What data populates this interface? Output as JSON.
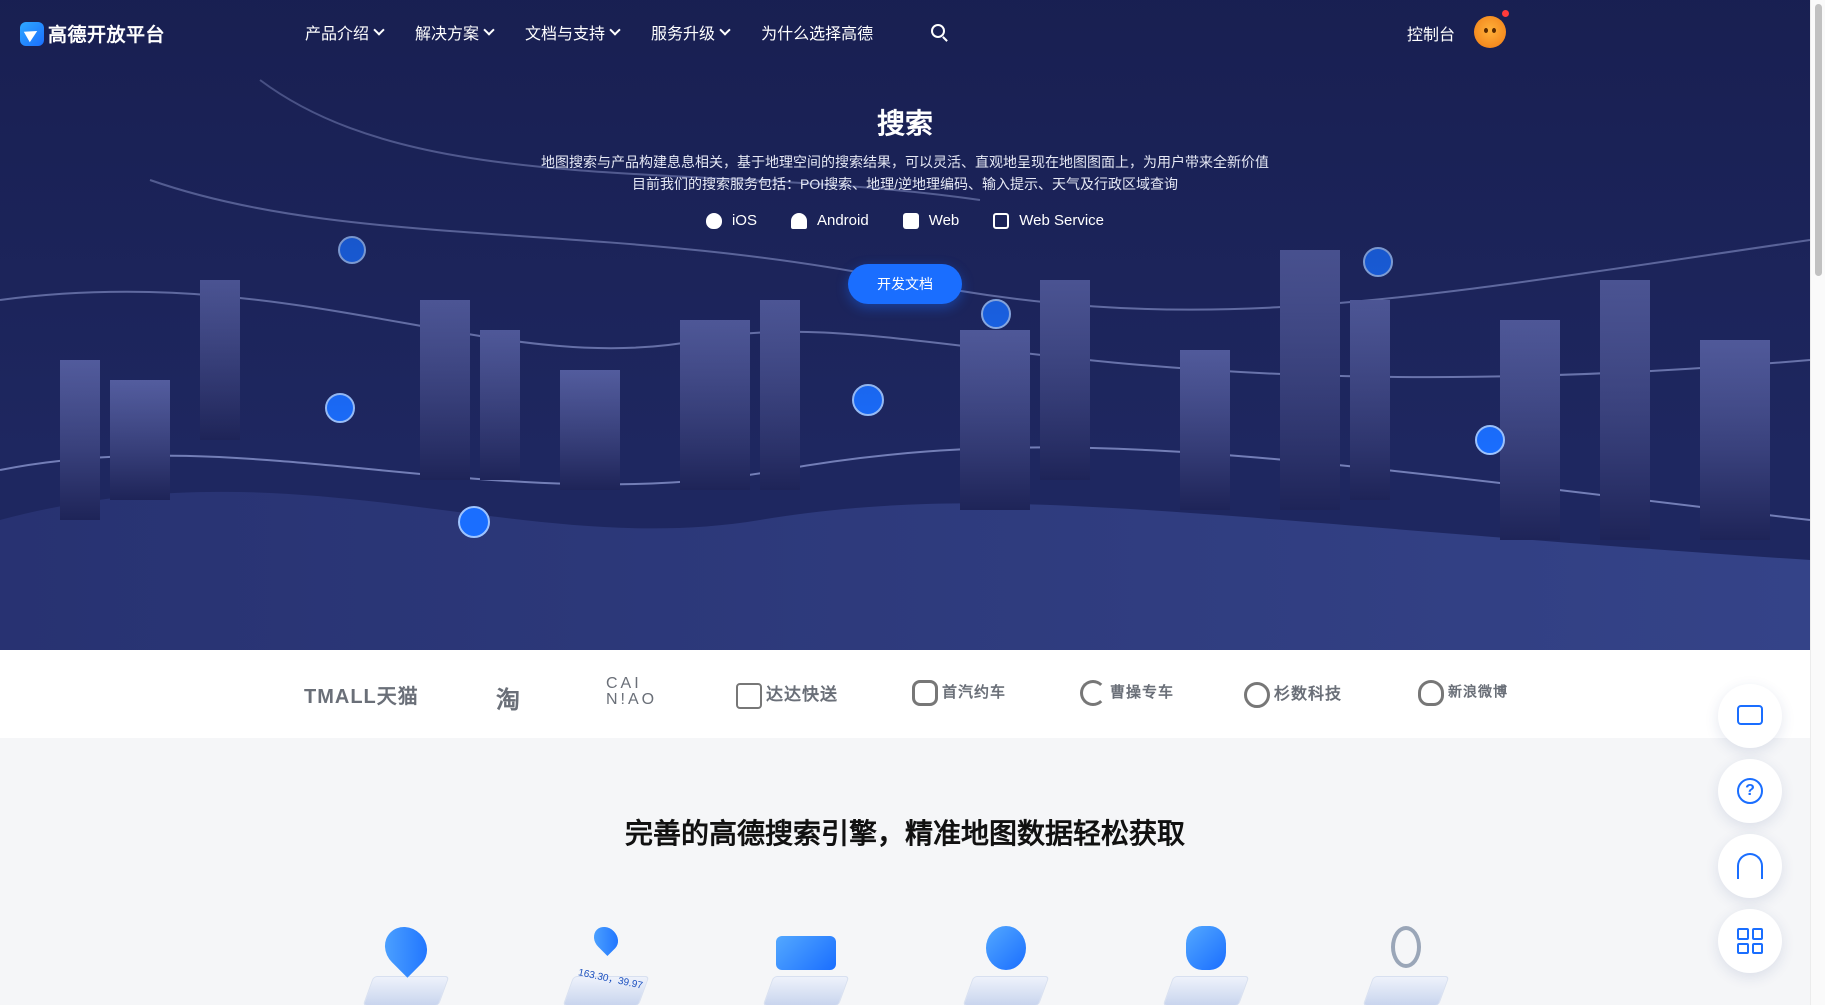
{
  "brand": {
    "name": "高德开放平台"
  },
  "nav": {
    "items": [
      {
        "label": "产品介绍",
        "dropdown": true
      },
      {
        "label": "解决方案",
        "dropdown": true
      },
      {
        "label": "文档与支持",
        "dropdown": true
      },
      {
        "label": "服务升级",
        "dropdown": true
      },
      {
        "label": "为什么选择高德",
        "dropdown": false
      }
    ],
    "search_icon": "search-icon",
    "console": "控制台"
  },
  "hero": {
    "title": "搜索",
    "desc_line1": "地图搜索与产品构建息息相关，基于地理空间的搜索结果，可以灵活、直观地呈现在地图图面上，为用户带来全新价值",
    "desc_line2": "目前我们的搜索服务包括：POI搜索、地理/逆地理编码、输入提示、天气及行政区域查询",
    "platforms": [
      {
        "icon": "apple-icon",
        "label": "iOS"
      },
      {
        "icon": "android-icon",
        "label": "Android"
      },
      {
        "icon": "monitor-icon",
        "label": "Web"
      },
      {
        "icon": "code-window-icon",
        "label": "Web Service"
      }
    ],
    "cta": "开发文档"
  },
  "partners": [
    "TMALL天猫",
    "淘",
    "CAI N!AO",
    "达达快送",
    "首汽约车",
    "曹操专车",
    "杉数科技",
    "新浪微博"
  ],
  "features": {
    "title": "完善的高德搜索引擎，精准地图数据轻松获取",
    "icons": [
      "store-pin-icon",
      "coordinate-pin-icon",
      "bus-icon",
      "globe-icon",
      "ip-cloud-icon",
      "ring-icon"
    ],
    "coord_text": "163.30，39.97"
  },
  "float_buttons": [
    "monitor-icon",
    "help-icon",
    "headset-icon",
    "qrcode-icon"
  ],
  "colors": {
    "accent": "#1a6eff",
    "hero_bg": "#1c2660"
  }
}
